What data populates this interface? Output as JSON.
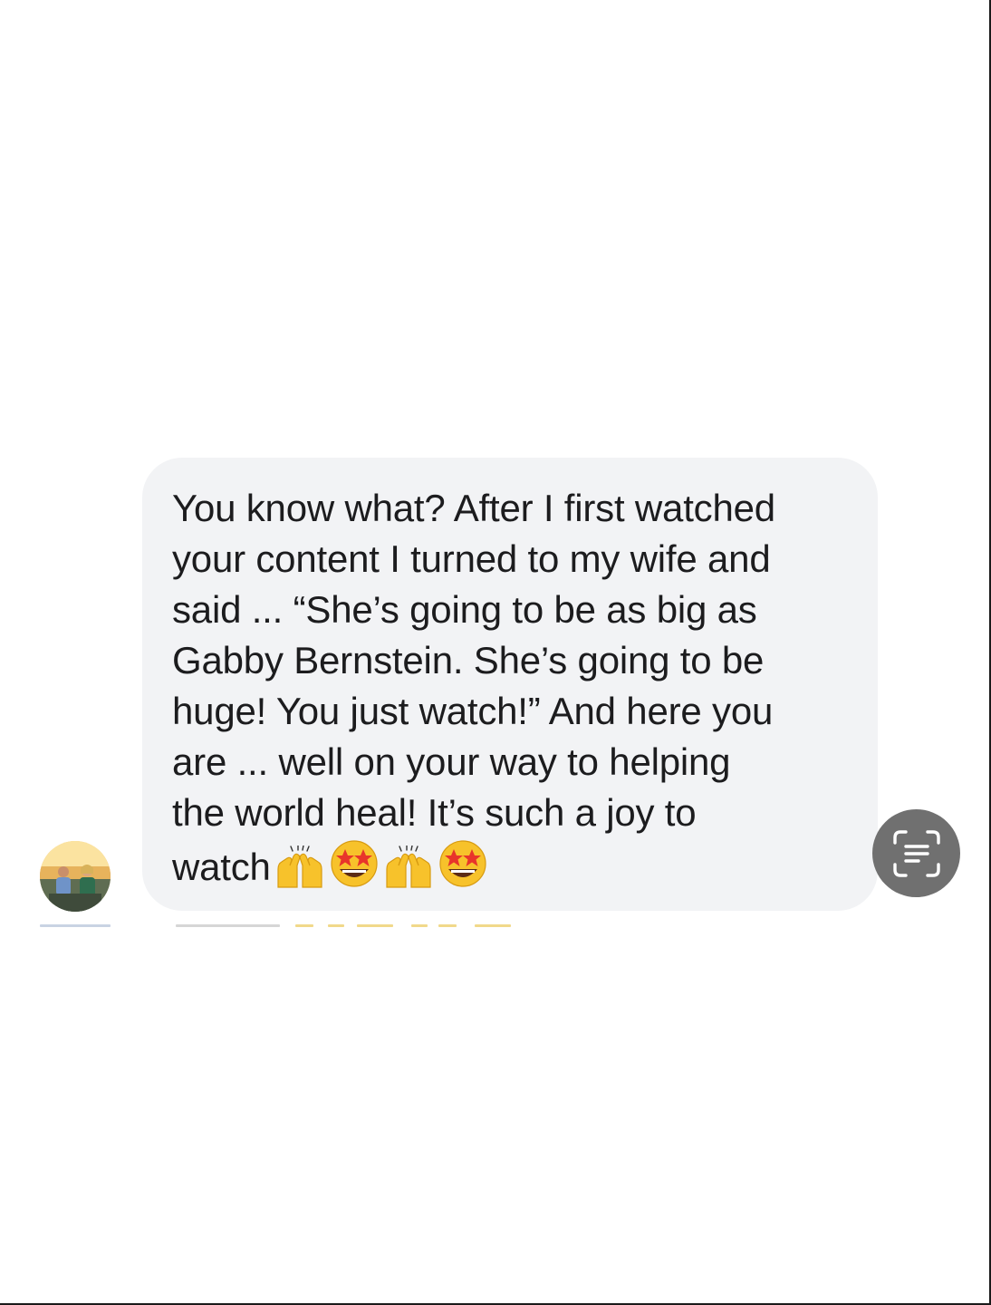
{
  "message": {
    "lines": [
      "You know what? After I first watched",
      "your content I turned to my wife and",
      "said ... “She’s going to be as big as",
      "Gabby Bernstein. She’s going to be",
      "huge! You just watch!” And here you",
      "are ... well on your way to helping",
      "the world heal! It’s such a joy to",
      "watch"
    ],
    "emojis": [
      "raising-hands-emoji",
      "star-struck-emoji",
      "raising-hands-emoji",
      "star-struck-emoji"
    ]
  },
  "sender": {
    "avatar_icon": "profile-photo"
  },
  "actions": {
    "scan_icon": "live-text-scan-icon"
  },
  "colors": {
    "bubble": "#f2f3f5",
    "text": "#1c1c1e",
    "scan_button": "#707070",
    "emoji_yellow": "#f7c22b"
  }
}
